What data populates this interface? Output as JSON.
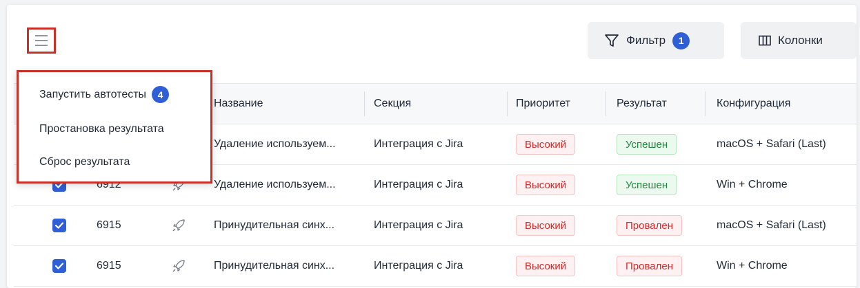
{
  "toolbar": {
    "menu_icon": "hamburger-icon",
    "filter_label": "Фильтр",
    "filter_icon": "filter-icon",
    "filter_count": "1",
    "columns_label": "Колонки",
    "columns_icon": "columns-icon"
  },
  "menu": {
    "items": [
      {
        "label": "Запустить автотесты",
        "badge": "4"
      },
      {
        "label": "Простановка результата"
      },
      {
        "label": "Сброс результата"
      }
    ]
  },
  "table": {
    "headers": {
      "name": "Название",
      "section": "Секция",
      "priority": "Приоритет",
      "result": "Результат",
      "configuration": "Конфигурация"
    },
    "rows": [
      {
        "id": "",
        "name": "Удаление используем...",
        "section": "Интеграция с Jira",
        "priority": "Высокий",
        "result": "Успешен",
        "result_status": "success",
        "configuration": "macOS + Safari (Last)"
      },
      {
        "id": "6912",
        "name": "Удаление используем...",
        "section": "Интеграция с Jira",
        "priority": "Высокий",
        "result": "Успешен",
        "result_status": "success",
        "configuration": "Win + Chrome"
      },
      {
        "id": "6915",
        "name": "Принудительная синх...",
        "section": "Интеграция с Jira",
        "priority": "Высокий",
        "result": "Провален",
        "result_status": "failed",
        "configuration": "macOS + Safari (Last)"
      },
      {
        "id": "6915",
        "name": "Принудительная синх...",
        "section": "Интеграция с Jira",
        "priority": "Высокий",
        "result": "Провален",
        "result_status": "failed",
        "configuration": "Win + Chrome"
      }
    ]
  },
  "colors": {
    "accent": "#2f5fd6",
    "highlight_outline": "#c8302a",
    "danger": "#d42a2a",
    "success": "#1f8a3b"
  }
}
